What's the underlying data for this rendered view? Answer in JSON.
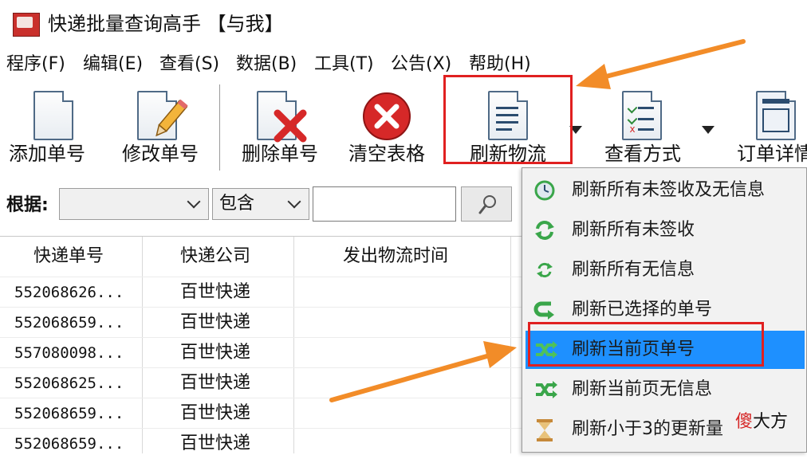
{
  "window": {
    "title": "快递批量查询高手 【与我】"
  },
  "menu": [
    "程序(F)",
    "编辑(E)",
    "查看(S)",
    "数据(B)",
    "工具(T)",
    "公告(X)",
    "帮助(H)"
  ],
  "toolbar": {
    "add": "添加单号",
    "edit": "修改单号",
    "delete": "删除单号",
    "clear": "清空表格",
    "refresh": "刷新物流",
    "view_mode": "查看方式",
    "order_detail": "订单详情"
  },
  "filter": {
    "label": "根据:",
    "field_value": "",
    "match_value": "包含",
    "search_value": ""
  },
  "grid": {
    "columns": [
      "快递单号",
      "快递公司",
      "发出物流时间"
    ],
    "rows": [
      {
        "number": "552068626...",
        "company": "百世快递"
      },
      {
        "number": "552068659...",
        "company": "百世快递"
      },
      {
        "number": "557080098...",
        "company": "百世快递"
      },
      {
        "number": "552068625...",
        "company": "百世快递"
      },
      {
        "number": "552068659...",
        "company": "百世快递"
      },
      {
        "number": "552068659...",
        "company": "百世快递"
      }
    ]
  },
  "context_menu": {
    "items": [
      {
        "label": "刷新所有未签收及无信息",
        "icon": "clock-refresh-icon"
      },
      {
        "label": "刷新所有未签收",
        "icon": "green-refresh-icon"
      },
      {
        "label": "刷新所有无信息",
        "icon": "small-refresh-icon"
      },
      {
        "label": "刷新已选择的单号",
        "icon": "arrow-return-icon"
      },
      {
        "label": "刷新当前页单号",
        "icon": "shuffle-icon",
        "selected": true
      },
      {
        "label": "刷新当前页无信息",
        "icon": "shuffle-green-icon"
      },
      {
        "label": "刷新小于3的更新量",
        "icon": "hourglass-icon"
      }
    ]
  },
  "watermark": {
    "prefix": "傻",
    "suffix": "大方"
  },
  "colors": {
    "highlight": "#1e90ff",
    "annotation_red": "#e02020",
    "annotation_orange": "#f28c28",
    "icon_green": "#3aa64a",
    "delete_red": "#d62828"
  }
}
